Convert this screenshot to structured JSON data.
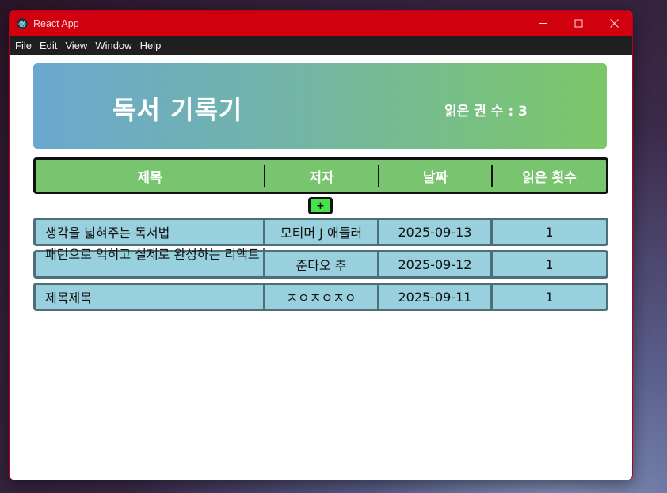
{
  "window": {
    "title": "React App",
    "menu": [
      "File",
      "Edit",
      "View",
      "Window",
      "Help"
    ]
  },
  "banner": {
    "title": "독서 기록기",
    "read_count_label": "읽은 권 수 : 3"
  },
  "table": {
    "headers": [
      "제목",
      "저자",
      "날짜",
      "읽은 횟수"
    ],
    "add_label": "+",
    "rows": [
      {
        "title": "생각을 넓혀주는 독서법",
        "author": "모티머 J 애들러",
        "date": "2025-09-13",
        "count": "1"
      },
      {
        "title": "패턴으로 익히고 실제로 완성하는 리액트",
        "author": "준타오 추",
        "date": "2025-09-12",
        "count": "1"
      },
      {
        "title": "제목제목",
        "author": "ㅈㅇㅈㅇㅈㅇ",
        "date": "2025-09-11",
        "count": "1"
      }
    ]
  },
  "colors": {
    "titlebar": "#d0000f",
    "menubar": "#1f1f1f",
    "banner_start": "#6aa8cf",
    "banner_end": "#7cc768",
    "header_row": "#78c46f",
    "add_button": "#45e24a",
    "data_row": "#98d0de",
    "row_border": "#4f6f78"
  }
}
